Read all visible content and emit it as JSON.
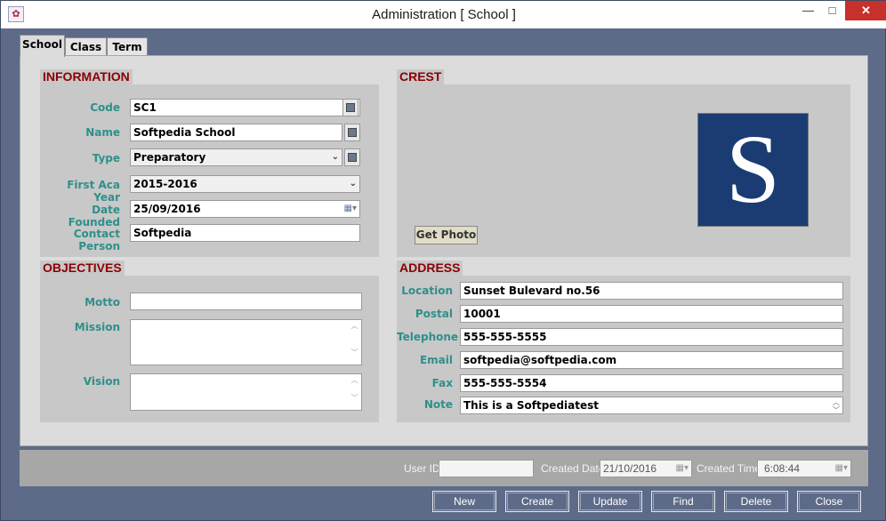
{
  "window": {
    "title": "Administration [ School ]"
  },
  "titlebar_buttons": {
    "minimize": "—",
    "maximize": "□",
    "close": "✕"
  },
  "tabs": [
    {
      "label": "School"
    },
    {
      "label": "Class"
    },
    {
      "label": "Term"
    }
  ],
  "information": {
    "header": "INFORMATION",
    "code": {
      "label": "Code",
      "value": "SC1"
    },
    "name": {
      "label": "Name",
      "value": "Softpedia School"
    },
    "type": {
      "label": "Type",
      "value": "Preparatory"
    },
    "first_aca_year": {
      "label": "First Aca Year",
      "value": "2015-2016"
    },
    "date_founded": {
      "label": "Date Founded",
      "value": "25/09/2016"
    },
    "contact_person": {
      "label": "Contact Person",
      "value": "Softpedia"
    }
  },
  "crest": {
    "header": "CREST",
    "image_letter": "S",
    "get_photo_label": "Get Photo"
  },
  "objectives": {
    "header": "OBJECTIVES",
    "motto": {
      "label": "Motto",
      "value": ""
    },
    "mission": {
      "label": "Mission",
      "value": ""
    },
    "vision": {
      "label": "Vision",
      "value": ""
    }
  },
  "address": {
    "header": "ADDRESS",
    "location": {
      "label": "Location",
      "value": "Sunset Bulevard no.56"
    },
    "postal": {
      "label": "Postal",
      "value": "10001"
    },
    "telephone": {
      "label": "Telephone",
      "value": "555-555-5555"
    },
    "email": {
      "label": "Email",
      "value": "softpedia@softpedia.com"
    },
    "fax": {
      "label": "Fax",
      "value": "555-555-5554"
    },
    "note": {
      "label": "Note",
      "value": "This is a Softpediatest"
    }
  },
  "footer": {
    "user_id": {
      "label": "User ID",
      "value": ""
    },
    "created_date": {
      "label": "Created Date",
      "value": "21/10/2016"
    },
    "created_time": {
      "label": "Created Time",
      "value": "6:08:44"
    }
  },
  "actions": {
    "new": "New",
    "create": "Create",
    "update": "Update",
    "find": "Find",
    "delete": "Delete",
    "close": "Close"
  },
  "colors": {
    "label": "#2f8f8a",
    "section_header": "#8b0000",
    "crest_bg": "#1b3b73"
  }
}
